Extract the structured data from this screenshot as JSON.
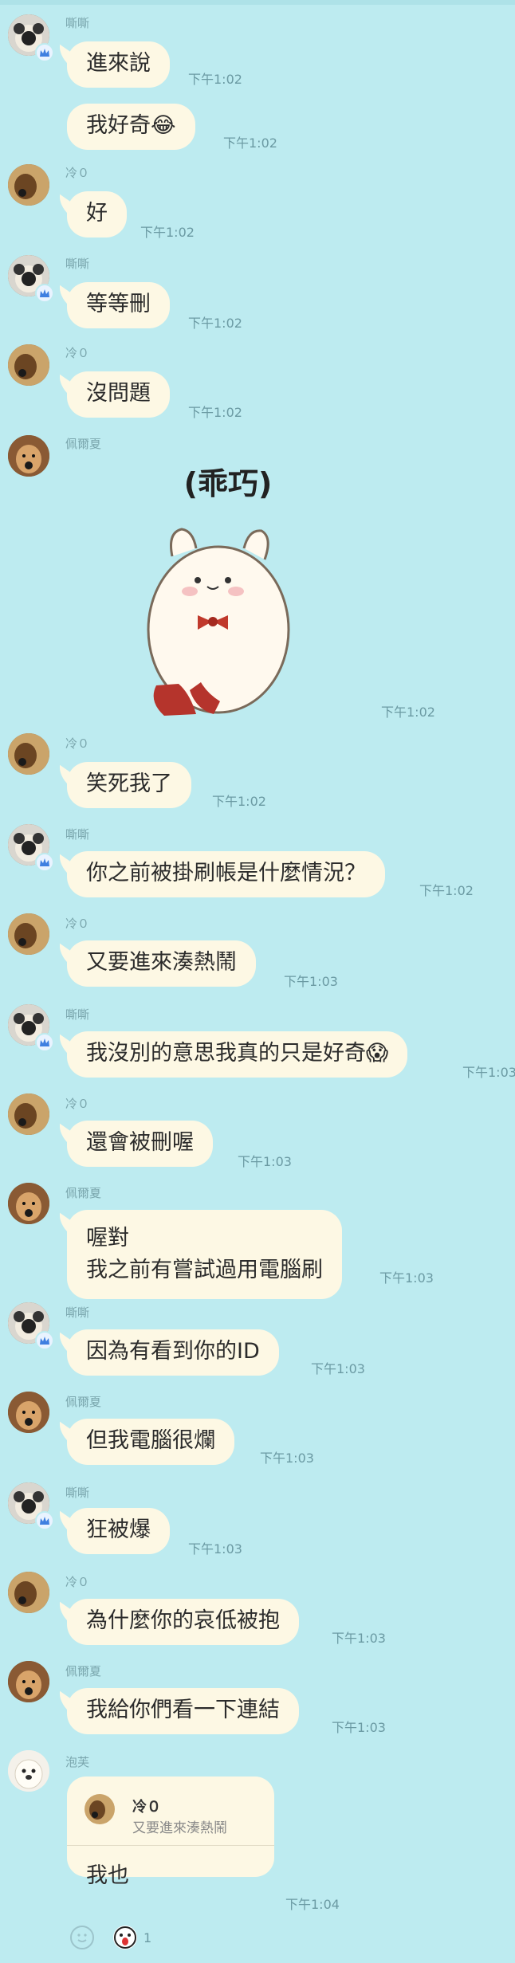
{
  "messages": [
    {
      "sender": "嘶嘶",
      "avatar": "pug",
      "text": "進來說",
      "time": "下午1:02"
    },
    {
      "sender": "",
      "avatar": "",
      "text": "我好奇😂",
      "time": "下午1:02"
    },
    {
      "sender": "冷０",
      "avatar": "dog",
      "text": "好",
      "time": "下午1:02"
    },
    {
      "sender": "嘶嘶",
      "avatar": "pug",
      "text": "等等刪",
      "time": "下午1:02"
    },
    {
      "sender": "冷０",
      "avatar": "dog",
      "text": "沒問題",
      "time": "下午1:02"
    },
    {
      "sender": "佩爾夏",
      "avatar": "dog2",
      "sticker": "(乖巧)",
      "time": "下午1:02"
    },
    {
      "sender": "冷０",
      "avatar": "dog",
      "text": "笑死我了",
      "time": "下午1:02"
    },
    {
      "sender": "嘶嘶",
      "avatar": "pug",
      "text": "你之前被掛刷帳是什麼情況？",
      "time": "下午1:02"
    },
    {
      "sender": "冷０",
      "avatar": "dog",
      "text": "又要進來湊熱鬧",
      "time": "下午1:03"
    },
    {
      "sender": "嘶嘶",
      "avatar": "pug",
      "text": "我沒別的意思我真的只是好奇😱",
      "time": "下午1:03"
    },
    {
      "sender": "冷０",
      "avatar": "dog",
      "text": "還會被刪喔",
      "time": "下午1:03"
    },
    {
      "sender": "佩爾夏",
      "avatar": "dog2",
      "line1": "喔對",
      "line2": "我之前有嘗試過用電腦刷",
      "time": "下午1:03"
    },
    {
      "sender": "嘶嘶",
      "avatar": "pug",
      "text": "因為有看到你的ID",
      "time": "下午1:03"
    },
    {
      "sender": "佩爾夏",
      "avatar": "dog2",
      "text": "但我電腦很爛",
      "time": "下午1:03"
    },
    {
      "sender": "嘶嘶",
      "avatar": "pug",
      "text": "狂被爆",
      "time": "下午1:03"
    },
    {
      "sender": "冷０",
      "avatar": "dog",
      "text": "為什麼你的哀低被抱",
      "time": "下午1:03"
    },
    {
      "sender": "佩爾夏",
      "avatar": "dog2",
      "text": "我給你們看一下連結",
      "time": "下午1:03"
    },
    {
      "sender": "泡芙",
      "avatar": "puppy",
      "quote_name": "冷０",
      "quote_text": "又要進來湊熱鬧",
      "text": "我也",
      "time": "下午1:04"
    }
  ],
  "reactions": {
    "count": "1"
  },
  "colors": {
    "background": "#bdebf0",
    "bubble": "#fdf8e4",
    "meta": "#6b9aa3"
  }
}
